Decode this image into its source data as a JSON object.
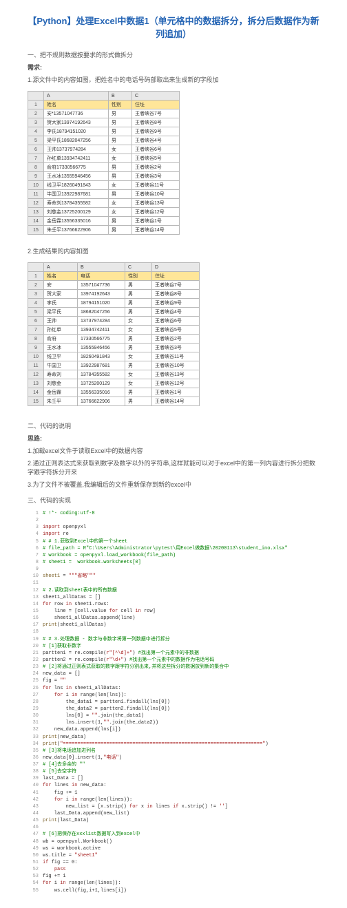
{
  "title": "【Python】处理Excel中数据1（单元格中的数据拆分，拆分后数据作为新列追加）",
  "s1": "一、把不规则数据按要求的形式做拆分",
  "req": "需求:",
  "p1": "1.源文件中的内容如图，把姓名中的电话号码部取出来生成新的字段加",
  "p2": "2.生成结果的内容如图",
  "t1h": [
    "",
    "A",
    "B",
    "C"
  ],
  "t1r": [
    [
      "1",
      "姓名",
      "性别",
      "住址"
    ],
    [
      "2",
      "安*13571047736",
      "男",
      "王者峡谷7号"
    ],
    [
      "3",
      "贺大家13974192643",
      "男",
      "王者峡谷8号"
    ],
    [
      "4",
      "李氏18794151020",
      "男",
      "王者峡谷9号"
    ],
    [
      "5",
      "梁平氏18682047256",
      "男",
      "王者峡谷4号"
    ],
    [
      "6",
      "王帅13737974284",
      "女",
      "王者峡谷6号"
    ],
    [
      "7",
      "孙红单13934742411",
      "女",
      "王者峡谷5号"
    ],
    [
      "8",
      "俞府17330566775",
      "男",
      "王者峡谷2号"
    ],
    [
      "9",
      "王水冰13555946456",
      "男",
      "王者峡谷3号"
    ],
    [
      "10",
      "线卫平18260491843",
      "女",
      "王者峡谷11号"
    ],
    [
      "11",
      "牛国卫13922987681",
      "男",
      "王者峡谷10号"
    ],
    [
      "12",
      "寿命刘13784355582",
      "女",
      "王者峡谷13号"
    ],
    [
      "13",
      "刘慈金13725200129",
      "女",
      "王者峡谷12号"
    ],
    [
      "14",
      "金岳霖13556335016",
      "男",
      "王者峡谷1号"
    ],
    [
      "15",
      "朱壬平13766622906",
      "男",
      "王者峡谷14号"
    ]
  ],
  "t2h": [
    "",
    "A",
    "B",
    "C",
    "D"
  ],
  "t2r": [
    [
      "1",
      "姓名",
      "电话",
      "性别",
      "住址"
    ],
    [
      "2",
      "安",
      "13571047736",
      "男",
      "王者峡谷7号"
    ],
    [
      "3",
      "贺大家",
      "13974192643",
      "男",
      "王者峡谷8号"
    ],
    [
      "4",
      "李氏",
      "18794151020",
      "男",
      "王者峡谷9号"
    ],
    [
      "5",
      "梁平氏",
      "18682047256",
      "男",
      "王者峡谷4号"
    ],
    [
      "6",
      "王帅",
      "13737974284",
      "女",
      "王者峡谷6号"
    ],
    [
      "7",
      "孙红单",
      "13934742411",
      "女",
      "王者峡谷5号"
    ],
    [
      "8",
      "俞府",
      "17330566775",
      "男",
      "王者峡谷2号"
    ],
    [
      "9",
      "王水冰",
      "13555946456",
      "男",
      "王者峡谷3号"
    ],
    [
      "10",
      "线卫平",
      "18260491843",
      "女",
      "王者峡谷11号"
    ],
    [
      "11",
      "牛国卫",
      "13922987681",
      "男",
      "王者峡谷10号"
    ],
    [
      "12",
      "寿命刘",
      "13784355582",
      "女",
      "王者峡谷13号"
    ],
    [
      "13",
      "刘慈金",
      "13725200129",
      "女",
      "王者峡谷12号"
    ],
    [
      "14",
      "金岳霖",
      "13556335016",
      "男",
      "王者峡谷1号"
    ],
    [
      "15",
      "朱壬平",
      "13766622906",
      "男",
      "王者峡谷14号"
    ]
  ],
  "s2": "二、代码的说明",
  "idea": "思路:",
  "i1": "1.加载excel文件于读取Excel中的数据内容",
  "i2": "2.通过正则表达式来获取到数字及数字以外的字符串,这样就能可以对于excel中的第一列内容进行拆分把数字跟字符拆分开来",
  "i3": "3.为了文件不被覆盖,我编辑后的文件重新保存到新的excel中",
  "s3": "三、代码的实现",
  "code": [
    {
      "n": 1,
      "h": "<span class='cm'># !*- coding:utf-8</span>"
    },
    {
      "n": 2,
      "h": ""
    },
    {
      "n": 3,
      "h": "<span class='kw'>import</span> openpyxl"
    },
    {
      "n": 4,
      "h": "<span class='kw'>import</span> re"
    },
    {
      "n": 5,
      "h": "<span class='cm'># # 1.获取到Excel中的第一个sheet</span>"
    },
    {
      "n": 6,
      "h": "<span class='cm'># file_path = R\"C:\\Users\\Administrator\\pytest\\用Excel做数据\\20200113\\student_ino.xlsx\"</span>"
    },
    {
      "n": 7,
      "h": "<span class='cm'># workbook = openpyxl.load_workbook(file_path)</span>"
    },
    {
      "n": 8,
      "h": "<span class='cm'># sheet1 =  workbook.worksheets[0]</span>"
    },
    {
      "n": 9,
      "h": ""
    },
    {
      "n": 10,
      "h": "<span class='fn'>sheet1</span> = <span class='st'>\"\"\"省略\"\"\"</span>"
    },
    {
      "n": 11,
      "h": ""
    },
    {
      "n": 12,
      "h": "<span class='cm'># 2.读取到sheet表中的所有数据</span>"
    },
    {
      "n": 13,
      "h": "sheet1_allDatas = []"
    },
    {
      "n": 14,
      "h": "<span class='kw'>for</span> row <span class='kw'>in</span> sheet1.rows:"
    },
    {
      "n": 15,
      "h": "    line = [cell.value <span class='kw'>for</span> cell <span class='kw'>in</span> row]"
    },
    {
      "n": 16,
      "h": "    sheet1_allDatas.append(line)"
    },
    {
      "n": 17,
      "h": "<span class='fn'>print</span>(sheet1_allDatas)"
    },
    {
      "n": 18,
      "h": ""
    },
    {
      "n": 19,
      "h": "<span class='cm'># # 3.处理数据 - 数字与非数字将第一列数据中进行拆分</span>"
    },
    {
      "n": 20,
      "h": "<span class='cm'># [1]获取非数字</span>"
    },
    {
      "n": 21,
      "h": "partten1 = re.compile(<span class='st'>r\"[^\\d]+\"</span>) <span class='cm'>#找出第一个元素中的非数据</span>"
    },
    {
      "n": 22,
      "h": "partten2 = re.compile(<span class='st'>r\"\\d+\"</span>) <span class='cm'>#找出第一个元素中的数据作为电话号码</span>"
    },
    {
      "n": 23,
      "h": "<span class='cm'># [2]将通过正则表式获取的数字跟字符分割出来,并将这些拆分的数据放到新的集合中</span>"
    },
    {
      "n": 24,
      "h": "new_data = []"
    },
    {
      "n": 25,
      "h": "fig = <span class='st'>\"\"</span>"
    },
    {
      "n": 26,
      "h": "<span class='kw'>for</span> lns <span class='kw'>in</span> sheet1_allDatas:"
    },
    {
      "n": 27,
      "h": "    <span class='kw'>for</span> i <span class='kw'>in</span> range(len(lns)):"
    },
    {
      "n": 28,
      "h": "        the_data1 = partten1.findall(lns[0])"
    },
    {
      "n": 29,
      "h": "        the_data2 = partten2.findall(lns[0])"
    },
    {
      "n": 30,
      "h": "        lns[0] = <span class='st'>\"\"</span>.join(the_data1)"
    },
    {
      "n": 31,
      "h": "        lns.insert(1,<span class='st'>\"\"</span>.join(the_data2))"
    },
    {
      "n": 32,
      "h": "    new_data.append(lns[i])"
    },
    {
      "n": 33,
      "h": "<span class='fn'>print</span>(new_data)"
    },
    {
      "n": 34,
      "h": "<span class='fn'>print</span>(<span class='st'>\"=====================================================================\"</span>)"
    },
    {
      "n": 35,
      "h": "<span class='cm'># [3]将电话追加进列名</span>"
    },
    {
      "n": 36,
      "h": "new_data[0].insert(1,<span class='st'>\"电话\"</span>)"
    },
    {
      "n": 37,
      "h": "<span class='cm'># [4]去多余的 \"\"</span>"
    },
    {
      "n": 38,
      "h": "<span class='cm'># [5]去空字符</span>"
    },
    {
      "n": 39,
      "h": "last_Data = []"
    },
    {
      "n": 40,
      "h": "<span class='kw'>for</span> lines <span class='kw'>in</span> new_data:"
    },
    {
      "n": 41,
      "h": "    fig += 1"
    },
    {
      "n": 42,
      "h": "    <span class='kw'>for</span> i <span class='kw'>in</span> range(len(lines)):"
    },
    {
      "n": 43,
      "h": "        new_list = [x.strip() <span class='kw'>for</span> x <span class='kw'>in</span> lines <span class='kw'>if</span> x.strip() != <span class='st'>''</span>]"
    },
    {
      "n": 44,
      "h": "    last_Data.append(new_list)"
    },
    {
      "n": 45,
      "h": "<span class='fn'>print</span>(last_Data)"
    },
    {
      "n": 46,
      "h": ""
    },
    {
      "n": 47,
      "h": "<span class='cm'># [6]把保存在xxxlist数据写入到excel中</span>"
    },
    {
      "n": 48,
      "h": "wb = openpyxl.Workbook()"
    },
    {
      "n": 49,
      "h": "ws = workbook.active"
    },
    {
      "n": 50,
      "h": "ws.title = <span class='st'>\"sheet1\"</span>"
    },
    {
      "n": 51,
      "h": "<span class='kw'>if</span> fig == 0:"
    },
    {
      "n": 52,
      "h": "    <span class='kw'>pass</span>"
    },
    {
      "n": 53,
      "h": "fig += 1"
    },
    {
      "n": 54,
      "h": "<span class='kw'>for</span> i <span class='kw'>in</span> range(len(lines)):"
    },
    {
      "n": 55,
      "h": "    ws.cell(fig,i+1,lines[i])"
    }
  ]
}
